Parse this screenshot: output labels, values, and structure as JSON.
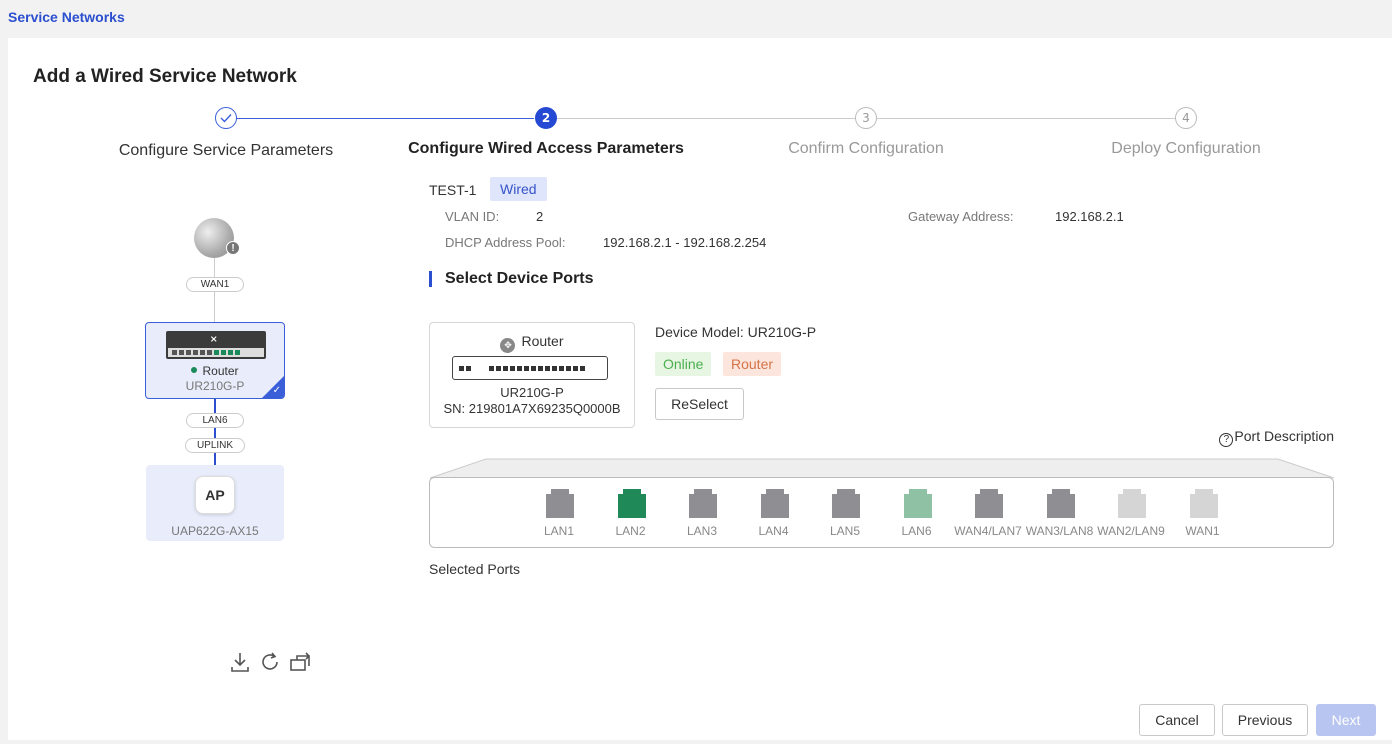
{
  "breadcrumb": "Service Networks",
  "title": "Add a Wired Service Network",
  "steps": [
    {
      "number": "1",
      "label": "Configure Service Parameters",
      "state": "done"
    },
    {
      "number": "2",
      "label": "Configure Wired Access Parameters",
      "state": "active"
    },
    {
      "number": "3",
      "label": "Confirm Configuration",
      "state": "todo"
    },
    {
      "number": "4",
      "label": "Deploy Configuration",
      "state": "todo"
    }
  ],
  "topology": {
    "wan_link": "WAN1",
    "router": {
      "name": "Router",
      "model": "UR210G-P",
      "status_color": "#1a8a5a"
    },
    "lan_link": "LAN6",
    "uplink": "UPLINK",
    "ap": {
      "label": "AP",
      "model": "UAP622G-AX15"
    },
    "tools": [
      "download-icon",
      "refresh-icon",
      "export-icon"
    ]
  },
  "network": {
    "name": "TEST-1",
    "type_tag": "Wired",
    "vlan_label": "VLAN ID:",
    "vlan_value": "2",
    "gateway_label": "Gateway Address:",
    "gateway_value": "192.168.2.1",
    "dhcp_label": "DHCP Address Pool:",
    "dhcp_value": "192.168.2.1 - 192.168.2.254"
  },
  "section_title": "Select Device Ports",
  "device": {
    "type": "Router",
    "model": "UR210G-P",
    "sn": "SN: 219801A7X69235Q0000B",
    "model_line": "Device Model: UR210G-P",
    "status": "Online",
    "role": "Router",
    "reselect": "ReSelect"
  },
  "port_description": "Port Description",
  "ports": [
    {
      "label": "LAN1",
      "state": "available",
      "color": "#8e8e93"
    },
    {
      "label": "LAN2",
      "state": "selected",
      "color": "#1f8a57"
    },
    {
      "label": "LAN3",
      "state": "available",
      "color": "#8e8e93"
    },
    {
      "label": "LAN4",
      "state": "available",
      "color": "#8e8e93"
    },
    {
      "label": "LAN5",
      "state": "available",
      "color": "#8e8e93"
    },
    {
      "label": "LAN6",
      "state": "uplink",
      "color": "#8fc2a5"
    },
    {
      "label": "WAN4/LAN7",
      "state": "available",
      "color": "#8e8e93"
    },
    {
      "label": "WAN3/LAN8",
      "state": "available",
      "color": "#8e8e93"
    },
    {
      "label": "WAN2/LAN9",
      "state": "disabled",
      "color": "#d5d5d5"
    },
    {
      "label": "WAN1",
      "state": "disabled",
      "color": "#d5d5d5"
    }
  ],
  "selected_ports_label": "Selected Ports",
  "footer": {
    "cancel": "Cancel",
    "previous": "Previous",
    "next": "Next"
  }
}
